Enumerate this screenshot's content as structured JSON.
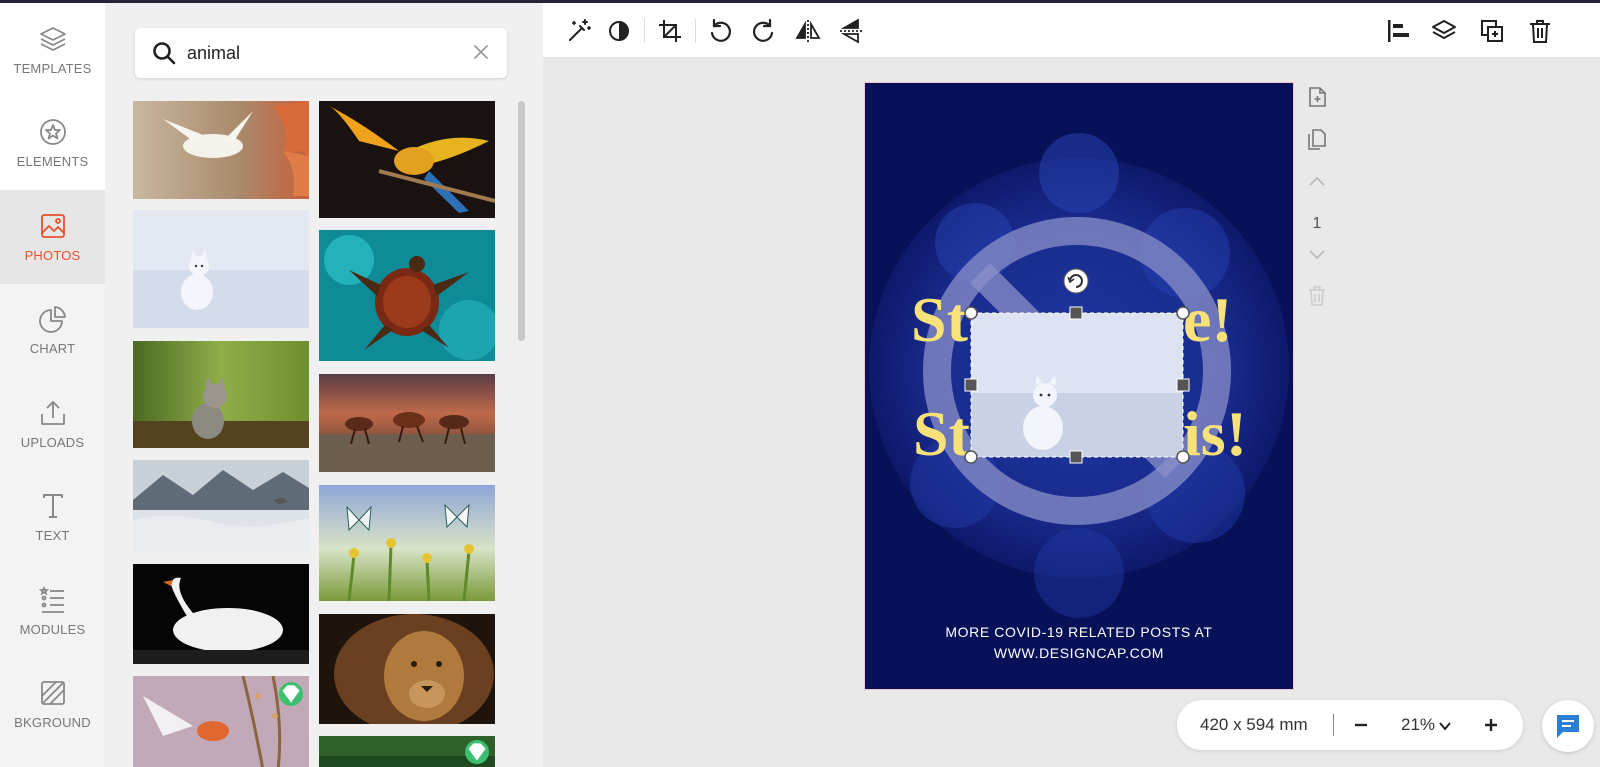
{
  "nav": {
    "items": [
      {
        "label": "TEMPLATES",
        "icon": "layers-icon"
      },
      {
        "label": "ELEMENTS",
        "icon": "star-badge-icon"
      },
      {
        "label": "PHOTOS",
        "icon": "image-icon",
        "active": true
      },
      {
        "label": "CHART",
        "icon": "pie-chart-icon"
      },
      {
        "label": "UPLOADS",
        "icon": "upload-icon"
      },
      {
        "label": "TEXT",
        "icon": "text-icon"
      },
      {
        "label": "MODULES",
        "icon": "list-icon"
      },
      {
        "label": "BKGROUND",
        "icon": "background-icon"
      }
    ]
  },
  "search": {
    "value": "animal",
    "icon": "search-icon",
    "clear_icon": "close-icon"
  },
  "photos": [
    {
      "subject": "white dove with orange leaves",
      "premium": false
    },
    {
      "subject": "macaw parrot in flight",
      "premium": false
    },
    {
      "subject": "arctic fox in snow",
      "premium": false
    },
    {
      "subject": "sea turtle",
      "premium": false
    },
    {
      "subject": "kitten in grass",
      "premium": false
    },
    {
      "subject": "running horses",
      "premium": false
    },
    {
      "subject": "misty mountains with wolf",
      "premium": false
    },
    {
      "subject": "butterflies on flowers",
      "premium": false
    },
    {
      "subject": "white swan",
      "premium": false
    },
    {
      "subject": "lion",
      "premium": false
    },
    {
      "subject": "bird in flight",
      "premium": true
    },
    {
      "subject": "green nature",
      "premium": true
    }
  ],
  "toolbar": {
    "left_tools": [
      "magic-wand-icon",
      "contrast-icon",
      "crop-icon",
      "rotate-left-icon",
      "rotate-right-icon",
      "flip-horizontal-icon",
      "flip-vertical-icon"
    ],
    "right_tools": [
      "align-icon",
      "layers-icon",
      "duplicate-icon",
      "delete-icon"
    ]
  },
  "page": {
    "background_color": "#071158",
    "heading_color": "#f7e27a",
    "headline_visible_line1_left": "St",
    "headline_visible_line1_right": "e!",
    "headline_visible_line2_left": "St",
    "headline_visible_line2_right": "is!",
    "footer_line1": "MORE COVID-19 RELATED POSTS AT",
    "footer_line2": "WWW.DESIGNCAP.COM"
  },
  "page_tools": {
    "page_number": "1",
    "icons": [
      "add-page-icon",
      "copy-page-icon",
      "page-up-icon",
      "page-down-icon",
      "delete-page-icon"
    ]
  },
  "zoom": {
    "dimensions": "420 x 594 mm",
    "level": "21%",
    "out_icon": "minus-icon",
    "in_icon": "plus-icon"
  },
  "chat": {
    "icon": "chat-icon",
    "color": "#2a7fd4"
  },
  "accent_color": "#e8522a"
}
